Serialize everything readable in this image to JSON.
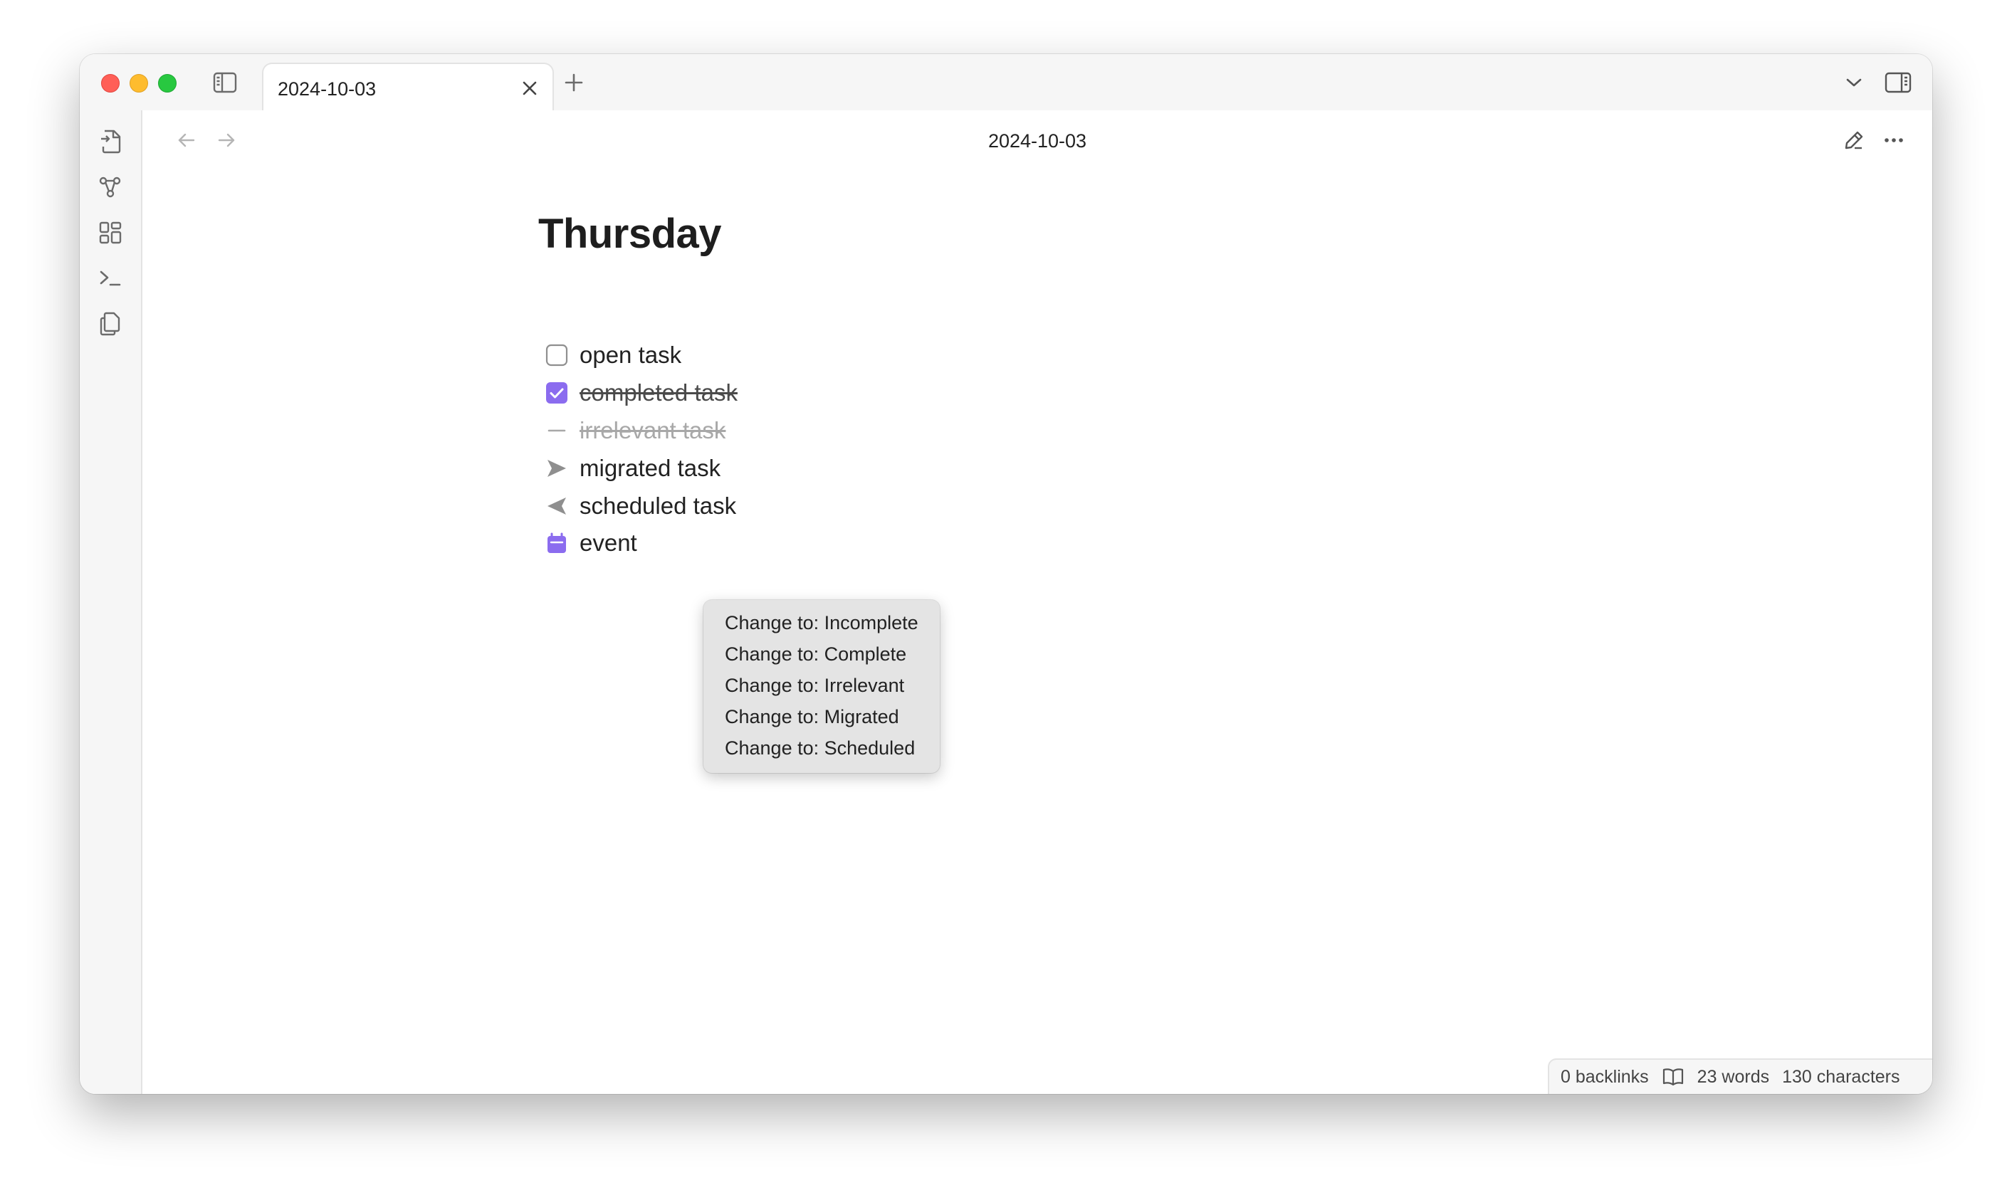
{
  "tab": {
    "title": "2024-10-03"
  },
  "note": {
    "nav_title": "2024-10-03",
    "heading": "Thursday",
    "tasks": [
      {
        "label": "open task",
        "state": "incomplete"
      },
      {
        "label": "completed task",
        "state": "complete"
      },
      {
        "label": "irrelevant task",
        "state": "irrelevant"
      },
      {
        "label": "migrated task",
        "state": "migrated"
      },
      {
        "label": "scheduled task",
        "state": "scheduled"
      },
      {
        "label": "event",
        "state": "event"
      }
    ]
  },
  "context_menu": {
    "items": [
      "Change to: Incomplete",
      "Change to: Complete",
      "Change to: Irrelevant",
      "Change to: Migrated",
      "Change to: Scheduled"
    ]
  },
  "status": {
    "backlinks": "0 backlinks",
    "words": "23 words",
    "characters": "130 characters"
  },
  "colors": {
    "accent": "#8b6cef",
    "muted_text": "#a8a8a8"
  },
  "icons": {
    "sidebar_toggle": "sidebar-left-icon",
    "new_tab": "plus-icon",
    "tab_list": "chevron-down-icon",
    "right_sidebar": "sidebar-right-icon",
    "ribbon": [
      "file-switch-icon",
      "graph-icon",
      "canvas-icon",
      "terminal-icon",
      "copy-icon"
    ],
    "back": "arrow-left-icon",
    "forward": "arrow-right-icon",
    "edit": "pencil-icon",
    "more": "more-horizontal-icon"
  }
}
